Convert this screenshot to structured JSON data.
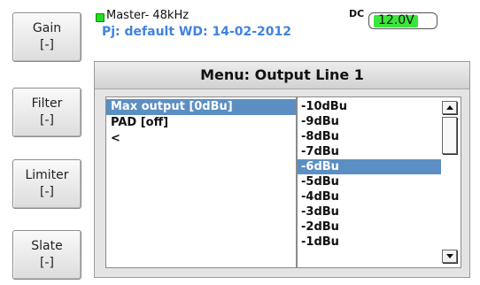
{
  "side_buttons": {
    "gain": {
      "label": "Gain",
      "value": "[-]"
    },
    "filter": {
      "label": "Filter",
      "value": "[-]"
    },
    "limiter": {
      "label": "Limiter",
      "value": "[-]"
    },
    "slate": {
      "label": "Slate",
      "value": "[-]"
    }
  },
  "status": {
    "master": "Master- 48kHz",
    "dc_label": "DC",
    "voltage": "12.0V",
    "project": "Pj: default  WD: 14-02-2012",
    "colors": {
      "led": "#22dd22",
      "battery": "#39e639",
      "project_text": "#3f83e0"
    }
  },
  "menu": {
    "title": "Menu: Output Line 1",
    "params": [
      {
        "label": "Max output [0dBu]",
        "selected": true
      },
      {
        "label": "PAD  [off]",
        "selected": false
      },
      {
        "label": "<",
        "selected": false
      }
    ],
    "values": [
      {
        "label": "-10dBu",
        "selected": false
      },
      {
        "label": "-9dBu",
        "selected": false
      },
      {
        "label": "-8dBu",
        "selected": false
      },
      {
        "label": "-7dBu",
        "selected": false
      },
      {
        "label": "-6dBu",
        "selected": true
      },
      {
        "label": "-5dBu",
        "selected": false
      },
      {
        "label": "-4dBu",
        "selected": false
      },
      {
        "label": "-3dBu",
        "selected": false
      },
      {
        "label": "-2dBu",
        "selected": false
      },
      {
        "label": "-1dBu",
        "selected": false
      }
    ],
    "selection_color": "#5b8fc3"
  }
}
